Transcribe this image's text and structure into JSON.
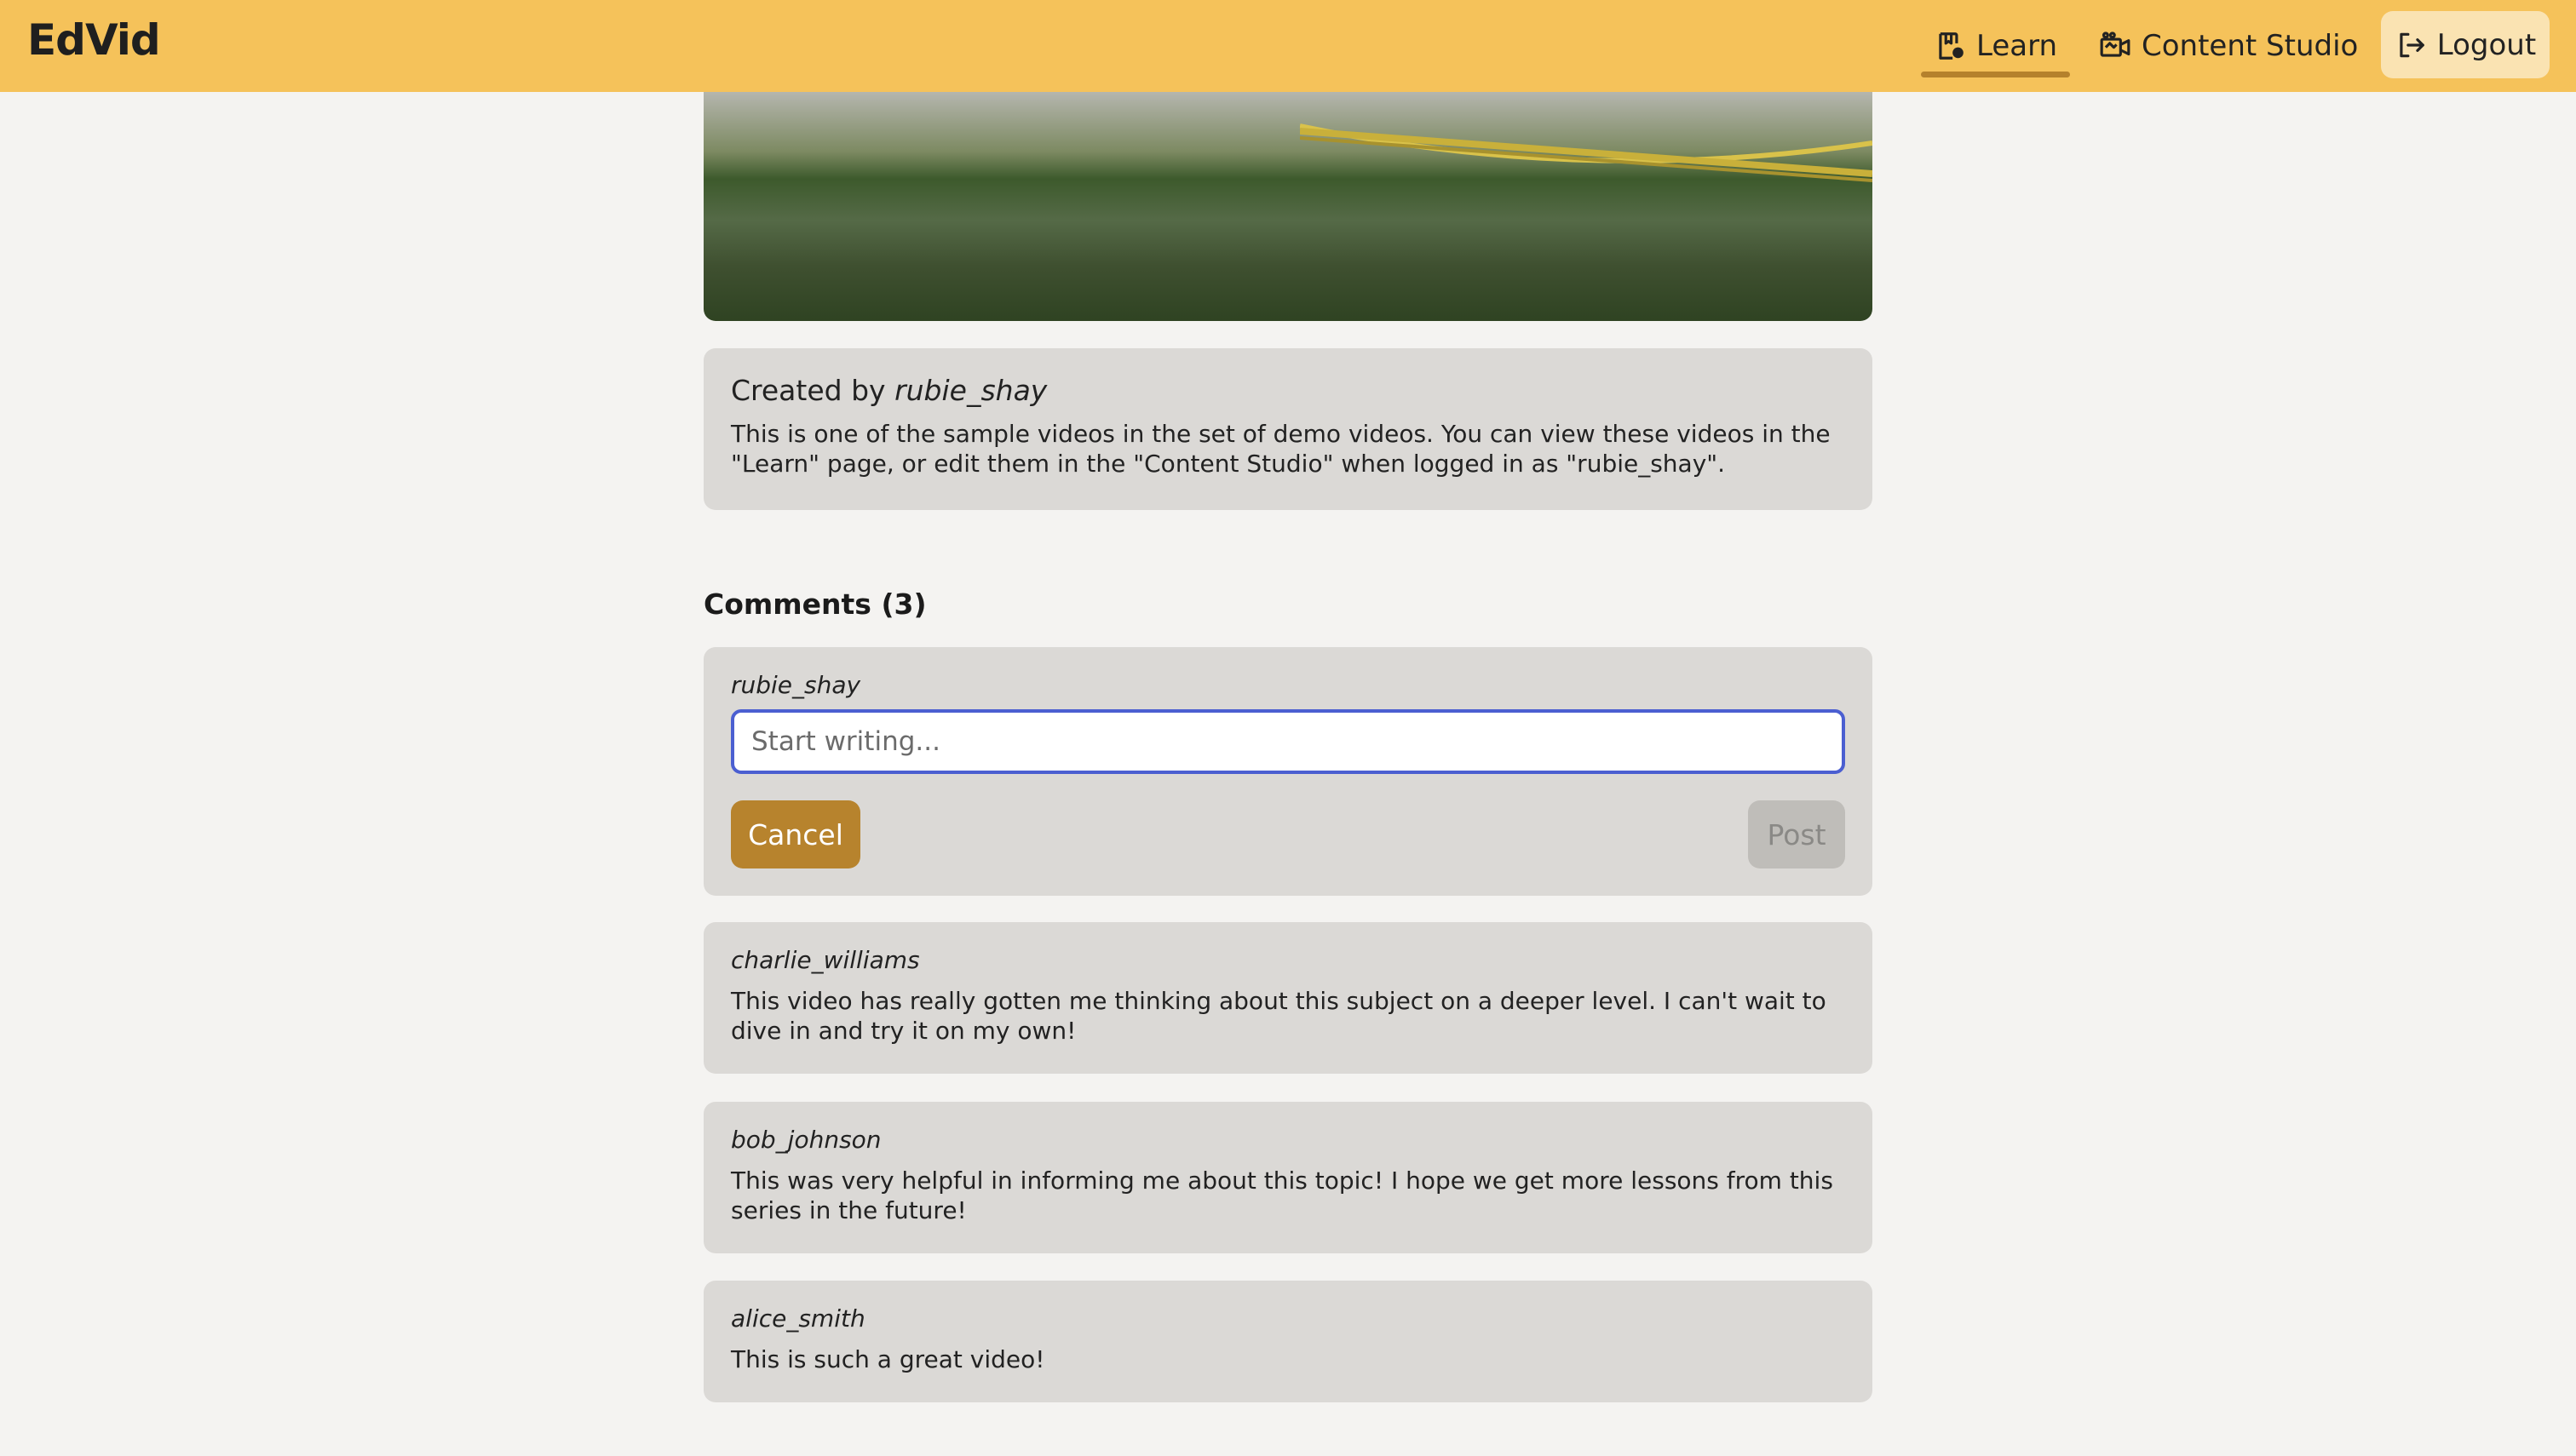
{
  "header": {
    "brand": "EdVid",
    "nav": {
      "learn_label": "Learn",
      "studio_label": "Content Studio",
      "logout_label": "Logout"
    },
    "active_tab": "Learn",
    "colors": {
      "bar": "#f5c25a",
      "accent": "#b5812c"
    }
  },
  "video_info": {
    "created_prefix": "Created by ",
    "creator": "rubie_shay",
    "description": "This is one of the sample videos in the set of demo videos. You can view these videos in the \"Learn\" page, or edit them in the \"Content Studio\" when logged in as \"rubie_shay\"."
  },
  "comments": {
    "title": "Comments (3)",
    "composer": {
      "user": "rubie_shay",
      "placeholder": "Start writing...",
      "value": "",
      "cancel_label": "Cancel",
      "post_label": "Post"
    },
    "items": [
      {
        "user": "charlie_williams",
        "text": "This video has really gotten me thinking about this subject on a deeper level. I can't wait to dive in and try it on my own!"
      },
      {
        "user": "bob_johnson",
        "text": "This was very helpful in informing me about this topic! I hope we get more lessons from this series in the future!"
      },
      {
        "user": "alice_smith",
        "text": "This is such a great video!"
      }
    ]
  }
}
